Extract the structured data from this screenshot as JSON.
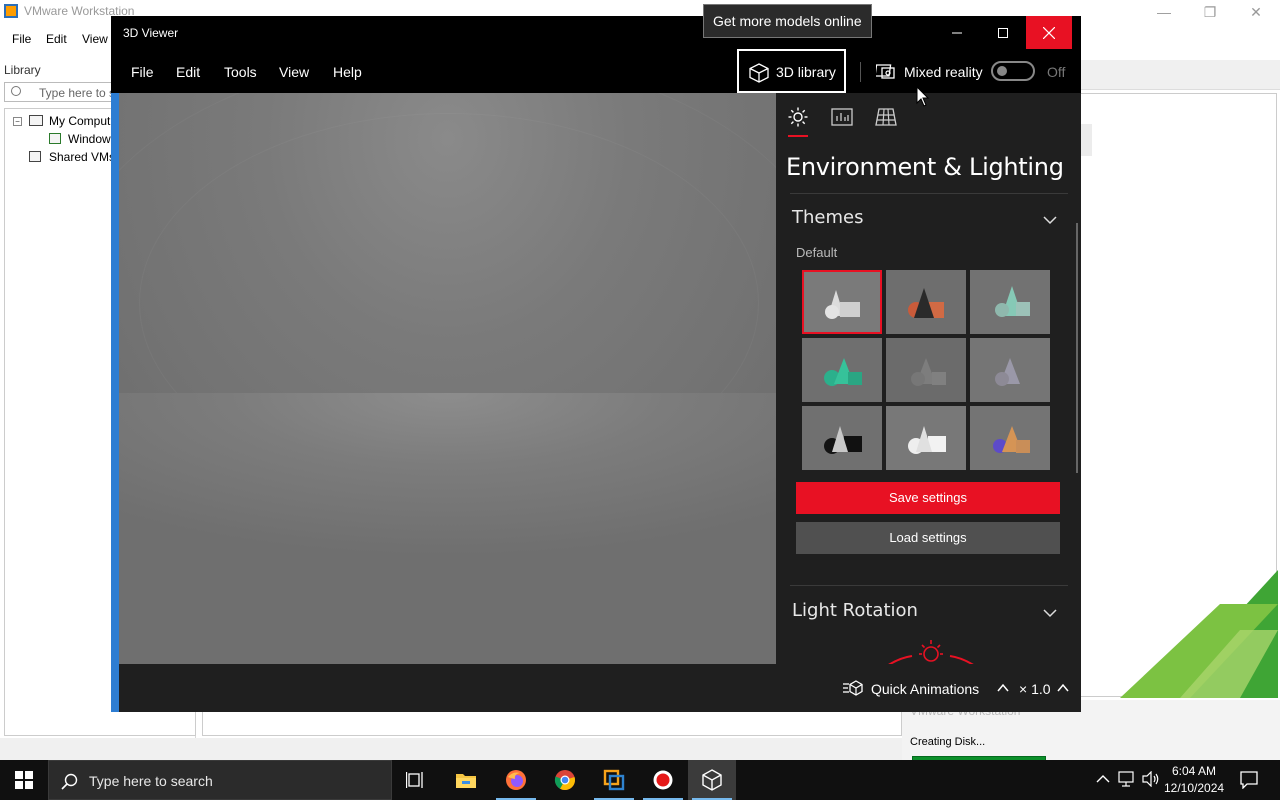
{
  "vmware": {
    "title": "VMware Workstation",
    "menu": [
      "File",
      "Edit",
      "View"
    ],
    "library_label": "Library",
    "search_placeholder": "Type here to s",
    "tree": [
      "My Comput",
      "Window",
      "Shared VMs"
    ],
    "task_ghost": "VMware Workstation",
    "task_status": "Creating Disk...",
    "task_progress": 0.35
  },
  "viewer": {
    "title": "3D Viewer",
    "tooltip": "Get more models online",
    "menu": [
      "File",
      "Edit",
      "Tools",
      "View",
      "Help"
    ],
    "library_button": "3D library",
    "mixed_reality_label": "Mixed reality",
    "mixed_reality_state": "Off",
    "panel": {
      "heading": "Environment & Lighting",
      "tabs": [
        "lighting-icon",
        "stats-icon",
        "grid-icon"
      ],
      "themes_title": "Themes",
      "themes_group": "Default",
      "themes_selected_index": 0,
      "save_label": "Save settings",
      "load_label": "Load settings",
      "rotation_title": "Light Rotation"
    },
    "bottom": {
      "animations_label": "Quick Animations",
      "speed_label": "× 1.0"
    }
  },
  "taskbar": {
    "search_placeholder": "Type here to search",
    "apps": [
      "task-view-icon",
      "file-explorer-icon",
      "firefox-icon",
      "chrome-icon",
      "vmware-icon",
      "recorder-icon",
      "3d-viewer-icon"
    ],
    "time": "6:04 AM",
    "date": "12/10/2024"
  },
  "colors": {
    "accent_red": "#e81123",
    "vm_progress": "#0b8f2a",
    "viewer_accent": "#2d7dd2"
  }
}
